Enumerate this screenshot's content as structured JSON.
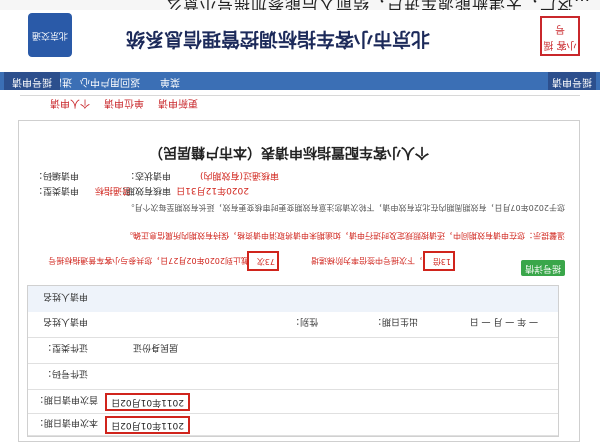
{
  "caption": "…这广，天津新能源车进户，结前入后能参加摇号小意么",
  "header": {
    "site_title": "北京市小客车指标调控管理信息系统",
    "logo_right_text": "北京交通",
    "seal_text": "小客 摇号"
  },
  "nav": {
    "left_tab": "摇号申请",
    "items": [
      "返回用户中心",
      "进出登录"
    ],
    "item_hint": "菜单",
    "right_tab": "摇号申请"
  },
  "subnav": {
    "items": [
      "个人申请",
      "单位申请",
      "更新申请"
    ]
  },
  "panel": {
    "title": "个人小客车配置指标申请表（本市户籍居民）",
    "apply_no_label": "申请编码：",
    "apply_type_label": "申请类型：",
    "apply_type_value": "普通指标",
    "status_label": "申请状态：",
    "status_value": "审核通过(有效期内)",
    "valid_label": "审核有效期：",
    "valid_value": "2020年12月31日",
    "notice_1": "您于2020年07月日，有效期周期内在北京有效申请，下轮次请您注意有效期变更时审核变更有效，延长有效期至每次个月。",
    "notice_2": "温馨提示：您在申请有效期间中，还请按照规定及时进行申请，如逾期未申请将取消申请资格，保持有效期内所属信息正确。",
    "notice_3": "截止到2020年02月27日，您共参与小客车普通指标摇号",
    "count_a": "73次",
    "notice_4": "，下次摇号中签倍率为阶梯递增",
    "count_b": "13倍",
    "view_button": "摇号详情"
  },
  "table": {
    "applicant_label": "申请人姓名",
    "gender_label": "性别：",
    "birth_label": "出生日期：",
    "birth_value": "一 年 一 月 一 日",
    "id_type_label": "证件类型：",
    "id_type_value": "居民身份证",
    "id_no_label": "证件号码：",
    "first_apply_label": "首次申请日期：",
    "first_apply_value": "2011年01月02日",
    "this_apply_label": "本次申请日期：",
    "this_apply_value": "2011年01月02日"
  }
}
